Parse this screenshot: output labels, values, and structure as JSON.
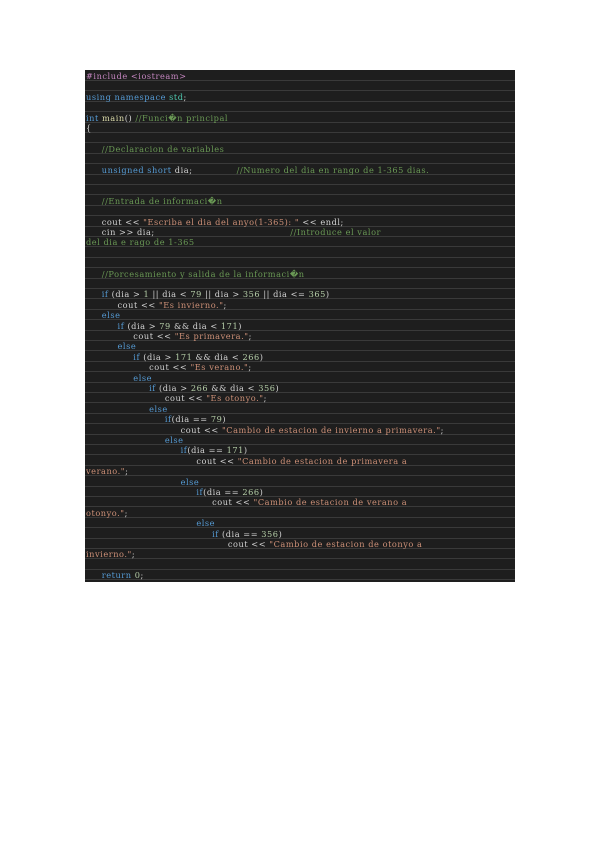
{
  "code": {
    "lines": [
      {
        "indent": "",
        "tokens": [
          {
            "k": "pp",
            "t": "#include <iostream>"
          }
        ]
      },
      {
        "indent": "",
        "tokens": []
      },
      {
        "indent": "",
        "tokens": [
          {
            "k": "kw",
            "t": "using namespace "
          },
          {
            "k": "ty",
            "t": "std"
          },
          {
            "k": "tx",
            "t": ";"
          }
        ]
      },
      {
        "indent": "",
        "tokens": []
      },
      {
        "indent": "",
        "tokens": [
          {
            "k": "kw",
            "t": "int "
          },
          {
            "k": "fn",
            "t": "main"
          },
          {
            "k": "tx",
            "t": "() "
          },
          {
            "k": "cm",
            "t": "//Funci�n principal"
          }
        ]
      },
      {
        "indent": "",
        "tokens": [
          {
            "k": "tx",
            "t": "{"
          }
        ]
      },
      {
        "indent": "",
        "tokens": []
      },
      {
        "indent": "     ",
        "tokens": [
          {
            "k": "cm",
            "t": "//Declaracion de variables"
          }
        ]
      },
      {
        "indent": "",
        "tokens": []
      },
      {
        "indent": "     ",
        "tokens": [
          {
            "k": "kw",
            "t": "unsigned short "
          },
          {
            "k": "tx",
            "t": "dia;              "
          },
          {
            "k": "cm",
            "t": "//Numero del dia en rango de 1-365 dias."
          }
        ]
      },
      {
        "indent": "",
        "tokens": []
      },
      {
        "indent": "",
        "tokens": []
      },
      {
        "indent": "     ",
        "tokens": [
          {
            "k": "cm",
            "t": "//Entrada de informaci�n"
          }
        ]
      },
      {
        "indent": "",
        "tokens": []
      },
      {
        "indent": "     ",
        "tokens": [
          {
            "k": "tx",
            "t": "cout << "
          },
          {
            "k": "st",
            "t": "\"Escriba el dia del anyo(1-365): \""
          },
          {
            "k": "tx",
            "t": " << endl;"
          }
        ]
      },
      {
        "indent": "     ",
        "tokens": [
          {
            "k": "tx",
            "t": "cin >> dia;                                           "
          },
          {
            "k": "cm",
            "t": "//Introduce el valor"
          }
        ]
      },
      {
        "indent": "",
        "tokens": [
          {
            "k": "cm",
            "t": "del dia e rago de 1-365"
          }
        ]
      },
      {
        "indent": "",
        "tokens": []
      },
      {
        "indent": "",
        "tokens": []
      },
      {
        "indent": "     ",
        "tokens": [
          {
            "k": "cm",
            "t": "//Porcesamiento y salida de la informaci�n"
          }
        ]
      },
      {
        "indent": "",
        "tokens": []
      },
      {
        "indent": "     ",
        "tokens": [
          {
            "k": "kw",
            "t": "if "
          },
          {
            "k": "tx",
            "t": "(dia > "
          },
          {
            "k": "nm",
            "t": "1"
          },
          {
            "k": "tx",
            "t": " || dia < "
          },
          {
            "k": "nm",
            "t": "79"
          },
          {
            "k": "tx",
            "t": " || dia > "
          },
          {
            "k": "nm",
            "t": "356"
          },
          {
            "k": "tx",
            "t": " || dia <= "
          },
          {
            "k": "nm",
            "t": "365"
          },
          {
            "k": "tx",
            "t": ")"
          }
        ]
      },
      {
        "indent": "          ",
        "tokens": [
          {
            "k": "tx",
            "t": "cout << "
          },
          {
            "k": "st",
            "t": "\"Es invierno.\""
          },
          {
            "k": "tx",
            "t": ";"
          }
        ]
      },
      {
        "indent": "     ",
        "tokens": [
          {
            "k": "kw",
            "t": "else"
          }
        ]
      },
      {
        "indent": "          ",
        "tokens": [
          {
            "k": "kw",
            "t": "if "
          },
          {
            "k": "tx",
            "t": "(dia > "
          },
          {
            "k": "nm",
            "t": "79"
          },
          {
            "k": "tx",
            "t": " && dia < "
          },
          {
            "k": "nm",
            "t": "171"
          },
          {
            "k": "tx",
            "t": ")"
          }
        ]
      },
      {
        "indent": "               ",
        "tokens": [
          {
            "k": "tx",
            "t": "cout << "
          },
          {
            "k": "st",
            "t": "\"Es primavera.\""
          },
          {
            "k": "tx",
            "t": ";"
          }
        ]
      },
      {
        "indent": "          ",
        "tokens": [
          {
            "k": "kw",
            "t": "else"
          }
        ]
      },
      {
        "indent": "               ",
        "tokens": [
          {
            "k": "kw",
            "t": "if "
          },
          {
            "k": "tx",
            "t": "(dia > "
          },
          {
            "k": "nm",
            "t": "171"
          },
          {
            "k": "tx",
            "t": " && dia < "
          },
          {
            "k": "nm",
            "t": "266"
          },
          {
            "k": "tx",
            "t": ")"
          }
        ]
      },
      {
        "indent": "                    ",
        "tokens": [
          {
            "k": "tx",
            "t": "cout << "
          },
          {
            "k": "st",
            "t": "\"Es verano.\""
          },
          {
            "k": "tx",
            "t": ";"
          }
        ]
      },
      {
        "indent": "               ",
        "tokens": [
          {
            "k": "kw",
            "t": "else"
          }
        ]
      },
      {
        "indent": "                    ",
        "tokens": [
          {
            "k": "kw",
            "t": "if "
          },
          {
            "k": "tx",
            "t": "(dia > "
          },
          {
            "k": "nm",
            "t": "266"
          },
          {
            "k": "tx",
            "t": " && dia < "
          },
          {
            "k": "nm",
            "t": "356"
          },
          {
            "k": "tx",
            "t": ")"
          }
        ]
      },
      {
        "indent": "                         ",
        "tokens": [
          {
            "k": "tx",
            "t": "cout << "
          },
          {
            "k": "st",
            "t": "\"Es otonyo.\""
          },
          {
            "k": "tx",
            "t": ";"
          }
        ]
      },
      {
        "indent": "                    ",
        "tokens": [
          {
            "k": "kw",
            "t": "else"
          }
        ]
      },
      {
        "indent": "                         ",
        "tokens": [
          {
            "k": "kw",
            "t": "if"
          },
          {
            "k": "tx",
            "t": "(dia == "
          },
          {
            "k": "nm",
            "t": "79"
          },
          {
            "k": "tx",
            "t": ")"
          }
        ]
      },
      {
        "indent": "                              ",
        "tokens": [
          {
            "k": "tx",
            "t": "cout << "
          },
          {
            "k": "st",
            "t": "\"Cambio de estacion de invierno a primavera.\""
          },
          {
            "k": "tx",
            "t": ";"
          }
        ]
      },
      {
        "indent": "                         ",
        "tokens": [
          {
            "k": "kw",
            "t": "else"
          }
        ]
      },
      {
        "indent": "                              ",
        "tokens": [
          {
            "k": "kw",
            "t": "if"
          },
          {
            "k": "tx",
            "t": "(dia == "
          },
          {
            "k": "nm",
            "t": "171"
          },
          {
            "k": "tx",
            "t": ")"
          }
        ]
      },
      {
        "indent": "                                   ",
        "tokens": [
          {
            "k": "tx",
            "t": "cout << "
          },
          {
            "k": "st",
            "t": "\"Cambio de estacion de primavera a"
          }
        ]
      },
      {
        "indent": "",
        "tokens": [
          {
            "k": "st",
            "t": "verano.\""
          },
          {
            "k": "tx",
            "t": ";"
          }
        ]
      },
      {
        "indent": "                              ",
        "tokens": [
          {
            "k": "kw",
            "t": "else"
          }
        ]
      },
      {
        "indent": "                                   ",
        "tokens": [
          {
            "k": "kw",
            "t": "if"
          },
          {
            "k": "tx",
            "t": "(dia == "
          },
          {
            "k": "nm",
            "t": "266"
          },
          {
            "k": "tx",
            "t": ")"
          }
        ]
      },
      {
        "indent": "                                        ",
        "tokens": [
          {
            "k": "tx",
            "t": "cout << "
          },
          {
            "k": "st",
            "t": "\"Cambio de estacion de verano a"
          }
        ]
      },
      {
        "indent": "",
        "tokens": [
          {
            "k": "st",
            "t": "otonyo.\""
          },
          {
            "k": "tx",
            "t": ";"
          }
        ]
      },
      {
        "indent": "                                   ",
        "tokens": [
          {
            "k": "kw",
            "t": "else"
          }
        ]
      },
      {
        "indent": "                                        ",
        "tokens": [
          {
            "k": "kw",
            "t": "if "
          },
          {
            "k": "tx",
            "t": "(dia == "
          },
          {
            "k": "nm",
            "t": "356"
          },
          {
            "k": "tx",
            "t": ")"
          }
        ]
      },
      {
        "indent": "                                             ",
        "tokens": [
          {
            "k": "tx",
            "t": "cout << "
          },
          {
            "k": "st",
            "t": "\"Cambio de estacion de otonyo a"
          }
        ]
      },
      {
        "indent": "",
        "tokens": [
          {
            "k": "st",
            "t": "invierno.\""
          },
          {
            "k": "tx",
            "t": ";"
          }
        ]
      },
      {
        "indent": "",
        "tokens": []
      },
      {
        "indent": "     ",
        "tokens": [
          {
            "k": "kw",
            "t": "return "
          },
          {
            "k": "nm",
            "t": "0"
          },
          {
            "k": "tx",
            "t": ";"
          }
        ]
      }
    ]
  }
}
